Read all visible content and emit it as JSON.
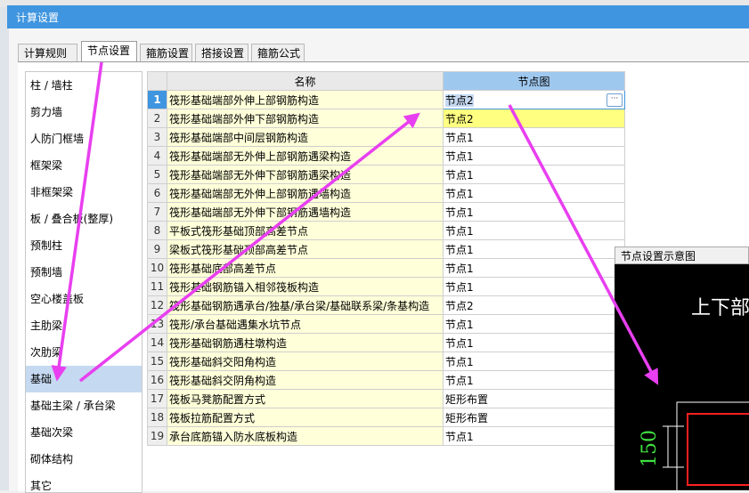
{
  "window": {
    "title": "计算设置"
  },
  "tabs": [
    {
      "label": "计算规则"
    },
    {
      "label": "节点设置"
    },
    {
      "label": "箍筋设置"
    },
    {
      "label": "搭接设置"
    },
    {
      "label": "箍筋公式"
    }
  ],
  "left_list": [
    "柱 / 墙柱",
    "剪力墙",
    "人防门框墙",
    "框架梁",
    "非框架梁",
    "板 / 叠合板(整厚)",
    "预制柱",
    "预制墙",
    "空心楼盖板",
    "主肋梁",
    "次肋梁",
    "基础",
    "基础主梁 / 承台梁",
    "基础次梁",
    "砌体结构",
    "其它"
  ],
  "grid": {
    "headers": {
      "name": "名称",
      "node": "节点图"
    },
    "rows": [
      {
        "no": "1",
        "name": "筏形基础端部外伸上部钢筋构造",
        "node": "节点2"
      },
      {
        "no": "2",
        "name": "筏形基础端部外伸下部钢筋构造",
        "node": "节点2"
      },
      {
        "no": "3",
        "name": "筏形基础端部中间层钢筋构造",
        "node": "节点1"
      },
      {
        "no": "4",
        "name": "筏形基础端部无外伸上部钢筋遇梁构造",
        "node": "节点1"
      },
      {
        "no": "5",
        "name": "筏形基础端部无外伸下部钢筋遇梁构造",
        "node": "节点1"
      },
      {
        "no": "6",
        "name": "筏形基础端部无外伸上部钢筋遇墙构造",
        "node": "节点1"
      },
      {
        "no": "7",
        "name": "筏形基础端部无外伸下部钢筋遇墙构造",
        "node": "节点1"
      },
      {
        "no": "8",
        "name": "平板式筏形基础顶部高差节点",
        "node": "节点1"
      },
      {
        "no": "9",
        "name": "梁板式筏形基础顶部高差节点",
        "node": "节点1"
      },
      {
        "no": "10",
        "name": "筏形基础底部高差节点",
        "node": "节点1"
      },
      {
        "no": "11",
        "name": "筏形基础钢筋锚入相邻筏板构造",
        "node": "节点1"
      },
      {
        "no": "12",
        "name": "筏形基础钢筋遇承台/独基/承台梁/基础联系梁/条基构造",
        "node": "节点2"
      },
      {
        "no": "13",
        "name": "筏形/承台基础遇集水坑节点",
        "node": "节点1"
      },
      {
        "no": "14",
        "name": "筏形基础钢筋遇柱墩构造",
        "node": "节点1"
      },
      {
        "no": "15",
        "name": "筏形基础斜交阳角构造",
        "node": "节点1"
      },
      {
        "no": "16",
        "name": "筏形基础斜交阴角构造",
        "node": "节点1"
      },
      {
        "no": "17",
        "name": "筏板马凳筋配置方式",
        "node": "矩形布置"
      },
      {
        "no": "18",
        "name": "筏板拉筋配置方式",
        "node": "矩形布置"
      },
      {
        "no": "19",
        "name": "承台底筋锚入防水底板构造",
        "node": "节点1"
      }
    ]
  },
  "preview": {
    "title": "节点设置示意图",
    "heading": "上下部",
    "dimension": "150"
  },
  "colors": {
    "titlebar": "#3f95df",
    "arrow": "#e83ff0",
    "selection": "#c5d9f1",
    "name_cell": "#ffffd9",
    "highlight_cell": "#ffff80"
  }
}
